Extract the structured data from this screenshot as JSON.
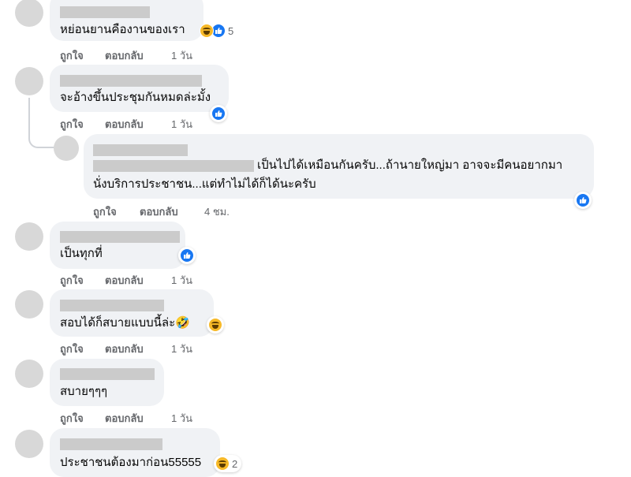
{
  "comments": [
    {
      "text": "หย่อนยานคืองานของเรา",
      "like": "ถูกใจ",
      "reply": "ตอบกลับ",
      "time": "1 วัน",
      "reaction_count": "5"
    },
    {
      "text": "จะอ้างขึ้นประชุมกันหมดล่ะมั้ง",
      "like": "ถูกใจ",
      "reply": "ตอบกลับ",
      "time": "1 วัน"
    },
    {
      "text_line1": "เป็นไปได้เหมือนกันครับ...ถ้านายใหญ่มา อาจจะมีคนอยากมา",
      "text_line2": "นั่งบริการประชาชน...แต่ทำไม่ได้ก็ได้นะครับ",
      "like": "ถูกใจ",
      "reply": "ตอบกลับ",
      "time": "4 ชม."
    },
    {
      "text": "เป็นทุกที่",
      "like": "ถูกใจ",
      "reply": "ตอบกลับ",
      "time": "1 วัน"
    },
    {
      "text": "สอบได้ก็สบายแบบนี้ล่ะ🤣",
      "like": "ถูกใจ",
      "reply": "ตอบกลับ",
      "time": "1 วัน"
    },
    {
      "text": "สบายๆๆๆ",
      "like": "ถูกใจ",
      "reply": "ตอบกลับ",
      "time": "1 วัน"
    },
    {
      "text": "ประชาชนต้องมาก่อน55555",
      "reaction_count": "2"
    }
  ],
  "colors": {
    "bubble": "#f0f2f5",
    "like_blue": "#1877f2",
    "haha_yellow": "#f7b928",
    "meta_gray": "#65676b"
  },
  "icons": {
    "like": "like-icon",
    "haha": "haha-icon"
  }
}
